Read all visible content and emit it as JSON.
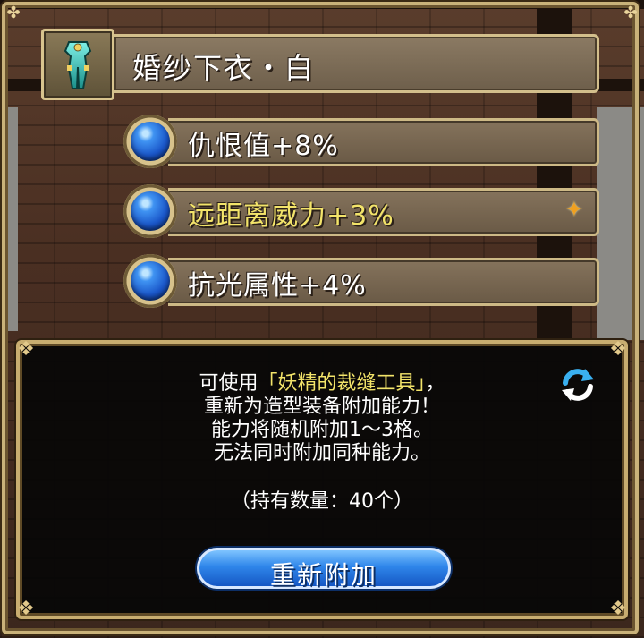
{
  "item": {
    "name": "婚纱下衣・白",
    "icon": "armor-pants-icon"
  },
  "abilities": [
    {
      "label": "仇恨值+8%",
      "highlight": false,
      "starred": false
    },
    {
      "label": "远距离威力+3%",
      "highlight": true,
      "starred": true
    },
    {
      "label": "抗光属性+4%",
      "highlight": false,
      "starred": false
    }
  ],
  "dialog": {
    "line1_prefix": "可使用",
    "line1_item": "「妖精的裁缝工具」",
    "line1_suffix": "，",
    "line2": "重新为造型装备附加能力！",
    "line3": "能力将随机附加1～3格。",
    "line4": "无法同时附加同种能力。",
    "holding": "（持有数量：40个）",
    "button_label": "重新附加"
  },
  "colors": {
    "highlight_text": "#f3e46a",
    "frame_gold": "#c9b27a",
    "button_blue": "#2f86ea",
    "orb_blue": "#1a56c9"
  }
}
